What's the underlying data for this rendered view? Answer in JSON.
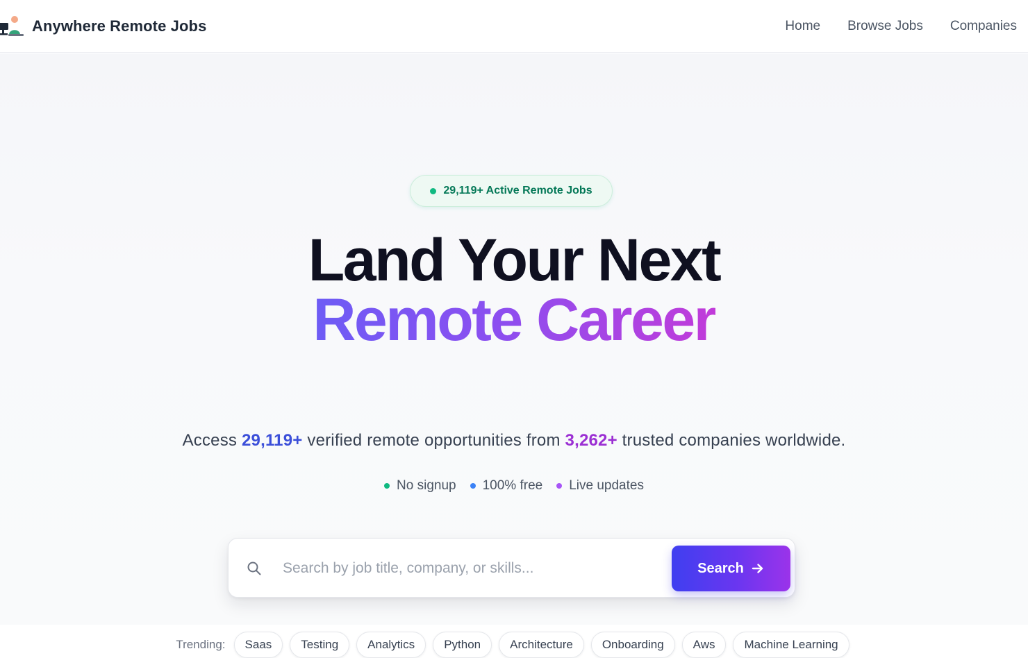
{
  "header": {
    "brand_name": "Anywhere Remote Jobs",
    "nav": [
      {
        "label": "Home"
      },
      {
        "label": "Browse Jobs"
      },
      {
        "label": "Companies"
      }
    ]
  },
  "hero": {
    "badge": "29,119+ Active Remote Jobs",
    "headline_line1": "Land Your Next",
    "headline_line2": "Remote Career",
    "subtitle": {
      "prefix": "Access ",
      "jobs_count": "29,119+",
      "middle": " verified remote opportunities from ",
      "companies_count": "3,262+",
      "suffix": " trusted companies worldwide."
    },
    "features": [
      {
        "label": "No signup",
        "color": "#10b981"
      },
      {
        "label": "100% free",
        "color": "#3b82f6"
      },
      {
        "label": "Live updates",
        "color": "#a855f7"
      }
    ]
  },
  "search": {
    "placeholder": "Search by job title, company, or skills...",
    "value": "",
    "button_label": "Search"
  },
  "trending": {
    "label": "Trending:",
    "tags": [
      "Saas",
      "Testing",
      "Analytics",
      "Python",
      "Architecture",
      "Onboarding",
      "Aws",
      "Machine Learning"
    ]
  },
  "colors": {
    "accent_blue": "#3b4fd9",
    "accent_purple": "#9b2fd3",
    "badge_green": "#10b981"
  },
  "icons": {
    "logo": "remote-workers-logo-icon",
    "search": "search-icon",
    "button_arrow": "arrow-right-icon"
  }
}
